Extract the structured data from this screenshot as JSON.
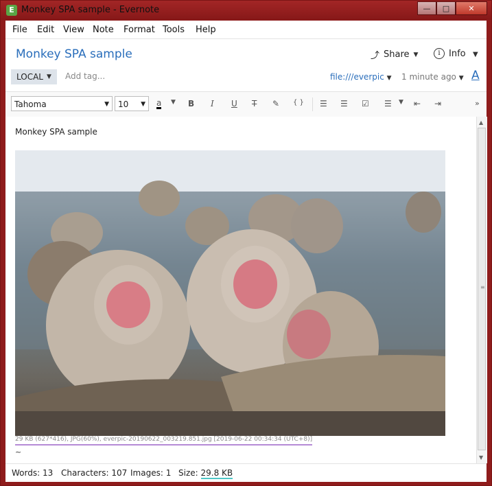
{
  "window": {
    "title": "Monkey SPA sample - Evernote",
    "app_icon_glyph": "E"
  },
  "menu": [
    "File",
    "Edit",
    "View",
    "Note",
    "Format",
    "Tools",
    "Help"
  ],
  "note": {
    "title": "Monkey SPA sample",
    "share_label": "Share",
    "info_label": "Info",
    "notebook": "LOCAL",
    "tag_placeholder": "Add tag...",
    "location": "file:///everpic",
    "updated": "1 minute ago",
    "font_color_glyph": "A"
  },
  "toolbar": {
    "font": "Tahoma",
    "size": "10",
    "font_color_letter": "a",
    "bold": "B",
    "italic": "I",
    "underline": "U",
    "strike": "T",
    "code": "{ }"
  },
  "body": {
    "text": "Monkey SPA sample",
    "image_caption": "29 KB (627*416), JPG(60%), everpic-20190622_003219.851.jpg [2019-06-22 00:34:34 (UTC+8)]",
    "tilde": "~"
  },
  "status": {
    "words_label": "Words: 13",
    "characters_label": "Characters: 107",
    "images_label": "Images: 1",
    "size_label": "Size: ",
    "size_value": "29.8 KB"
  },
  "colors": {
    "accent": "#2a6ebb",
    "titlebar": "#8f1c1c",
    "caption_underline": "#b58ad6",
    "size_underline": "#4fc7c7"
  }
}
